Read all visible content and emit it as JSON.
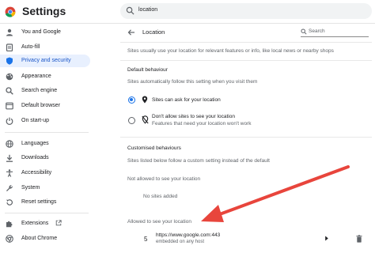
{
  "app": {
    "title": "Settings"
  },
  "search": {
    "value": "location"
  },
  "sidebar": {
    "items": [
      {
        "label": "You and Google"
      },
      {
        "label": "Auto-fill"
      },
      {
        "label": "Privacy and security",
        "active": true
      },
      {
        "label": "Appearance"
      },
      {
        "label": "Search engine"
      },
      {
        "label": "Default browser"
      },
      {
        "label": "On start-up"
      },
      {
        "label": "Languages"
      },
      {
        "label": "Downloads"
      },
      {
        "label": "Accessibility"
      },
      {
        "label": "System"
      },
      {
        "label": "Reset settings"
      },
      {
        "label": "Extensions"
      },
      {
        "label": "About Chrome"
      }
    ]
  },
  "page": {
    "title": "Location",
    "search_placeholder": "Search",
    "intro": "Sites usually use your location for relevant features or info, like local news or nearby shops",
    "default_behaviour": {
      "heading": "Default behaviour",
      "description": "Sites automatically follow this setting when you visit them",
      "options": [
        {
          "label": "Sites can ask for your location",
          "sublabel": "",
          "selected": true
        },
        {
          "label": "Don't allow sites to see your location",
          "sublabel": "Features that need your location won't work",
          "selected": false
        }
      ]
    },
    "custom": {
      "heading": "Customised behaviours",
      "description": "Sites listed below follow a custom setting instead of the default",
      "not_allowed": {
        "heading": "Not allowed to see your location",
        "empty": "No sites added"
      },
      "allowed": {
        "heading": "Allowed to see your location",
        "sites": [
          {
            "url": "https://www.google.com:443",
            "detail": "embedded on any host",
            "icon": "5"
          }
        ]
      }
    }
  },
  "colors": {
    "accent": "#1a73e8",
    "annotation_arrow": "#e8453c"
  }
}
